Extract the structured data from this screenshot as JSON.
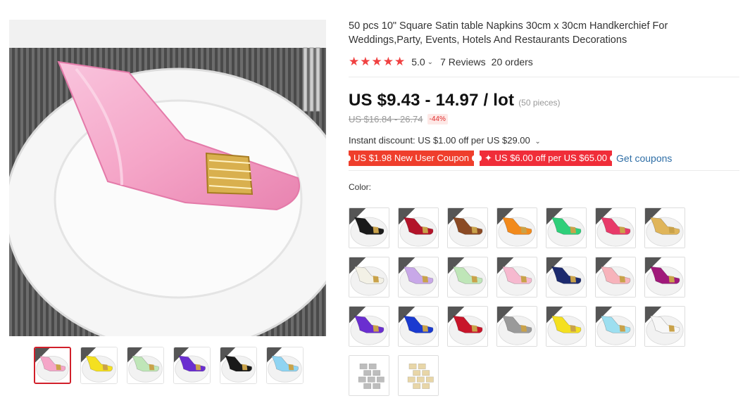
{
  "product": {
    "title": "50 pcs 10\" Square Satin table Napkins 30cm x 30cm Handkerchief For Weddings,Party, Events, Hotels And Restaurants Decorations",
    "stars": "★★★★★",
    "rating": "5.0",
    "reviews": "7 Reviews",
    "orders": "20 orders"
  },
  "price": {
    "current": "US $9.43 - 14.97 / lot",
    "pieces": "(50 pieces)",
    "original": "US $16.84 - 26.74",
    "discount": "-44%",
    "instant_discount": "Instant discount: US $1.00 off per US $29.00"
  },
  "coupons": {
    "new_user": "US $1.98 New User Coupon",
    "store": "✦ US $6.00 off per US $65.00",
    "get_coupons": "Get coupons"
  },
  "colors": {
    "label": "Color:",
    "swatch_colors": [
      [
        "#1a1a1a",
        "#b3142a",
        "#8b4a24",
        "#f28a1c",
        "#2fcf7a",
        "#e83a6a",
        "#e0b55a"
      ],
      [
        "#f3f1e6",
        "#c8a8e8",
        "#bfe6b8",
        "#f6b9cf",
        "#1c2a6e",
        "#f7b3bb",
        "#a0197a"
      ],
      [
        "#6a2ed0",
        "#1a3ad0",
        "#c8152a",
        "#9a9a9a",
        "#f4e020",
        "#9ddff0",
        "#f7f7f7"
      ],
      [
        "#bdbdbd",
        "#e8d6a8"
      ]
    ]
  },
  "gallery": {
    "main_color": "#f5a6c8",
    "thumb_colors": [
      "#f5a6c8",
      "#f4e020",
      "#bfe6b8",
      "#6a2ed0",
      "#1a1a1a",
      "#8fd4f2"
    ]
  }
}
